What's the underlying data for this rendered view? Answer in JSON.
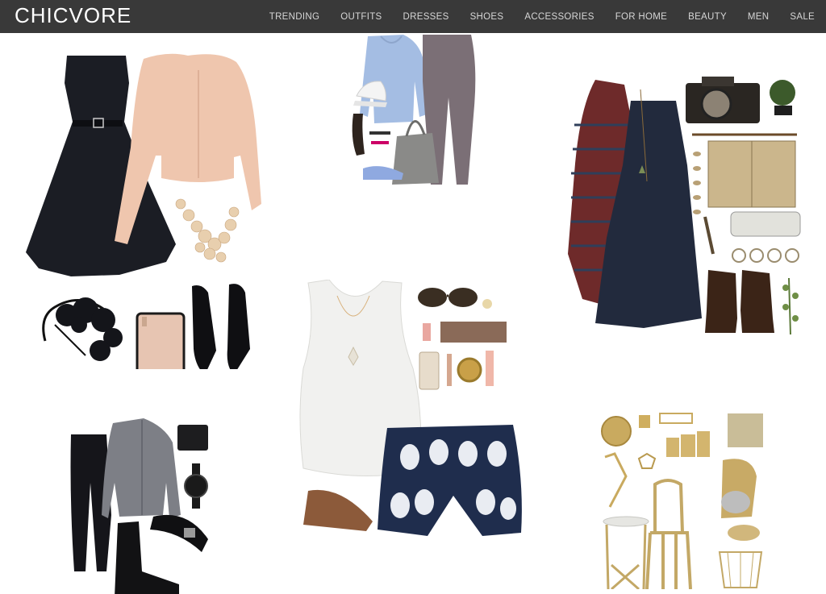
{
  "header": {
    "logo": "CHICVORE",
    "nav": [
      {
        "label": "TRENDING"
      },
      {
        "label": "OUTFITS"
      },
      {
        "label": "DRESSES"
      },
      {
        "label": "SHOES"
      },
      {
        "label": "ACCESSORIES"
      },
      {
        "label": "FOR HOME"
      },
      {
        "label": "BEAUTY"
      },
      {
        "label": "MEN"
      },
      {
        "label": "SALE"
      }
    ]
  },
  "collages": [
    {
      "id": "black-dress-outfit",
      "items": [
        "black-dress",
        "peach-cardigan",
        "pearl-necklace",
        "black-pumps",
        "flower-headband",
        "blush-wallet"
      ]
    },
    {
      "id": "athleisure-outfit",
      "items": [
        "blue-hoodie",
        "grey-leggings",
        "white-cap",
        "suede-bucket-bag",
        "blue-sneakers"
      ]
    },
    {
      "id": "boho-dress-outfit",
      "items": [
        "striped-cardigan",
        "navy-slip-dress",
        "film-camera",
        "bonsai",
        "paintbrush",
        "old-book",
        "brown-boots",
        "rings",
        "plant-sprig"
      ]
    },
    {
      "id": "white-tank-outfit",
      "items": [
        "white-tank",
        "sunglasses",
        "eyeshadow-palette",
        "phone",
        "gold-watch",
        "printed-shorts",
        "sandals"
      ]
    },
    {
      "id": "mens-outfit",
      "items": [
        "black-jeans",
        "grey-shirt",
        "wallet",
        "watch",
        "belt",
        "chelsea-boots"
      ]
    },
    {
      "id": "gold-home-decor",
      "items": [
        "gold-clock",
        "gold-chair",
        "side-table",
        "cushion",
        "stand-mixer",
        "wire-basket",
        "lamp",
        "canisters"
      ]
    }
  ],
  "colors": {
    "topbar": "#393939",
    "nav_text": "#d6d6d6",
    "logo": "#ffffff"
  }
}
